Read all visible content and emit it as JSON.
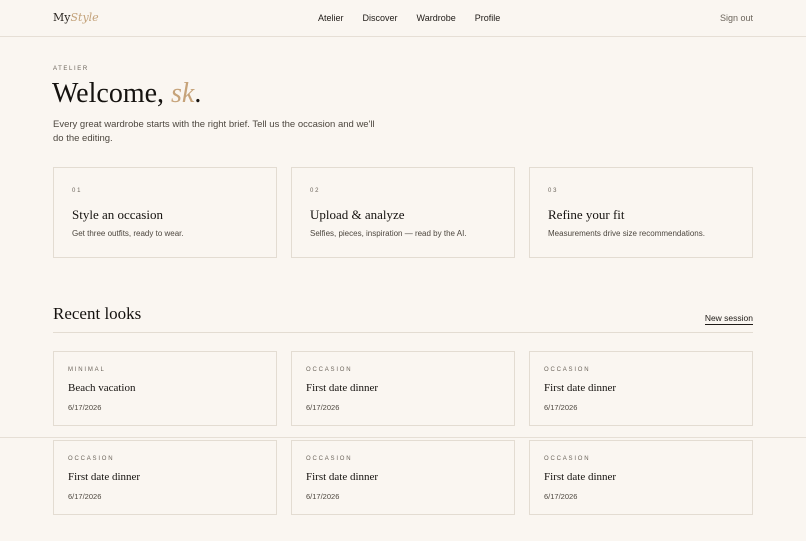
{
  "header": {
    "logo_main": "My",
    "logo_accent": "Style",
    "nav": [
      "Atelier",
      "Discover",
      "Wardrobe",
      "Profile"
    ],
    "signout": "Sign out"
  },
  "hero": {
    "eyebrow": "ATELIER",
    "welcome": "Welcome, ",
    "user": "sk",
    "period": ".",
    "intro": "Every great wardrobe starts with the right brief. Tell us the occasion and we'll do the editing."
  },
  "steps": [
    {
      "num": "01",
      "title": "Style an occasion",
      "desc": "Get three outfits, ready to wear."
    },
    {
      "num": "02",
      "title": "Upload & analyze",
      "desc": "Selfies, pieces, inspiration — read by the AI."
    },
    {
      "num": "03",
      "title": "Refine your fit",
      "desc": "Measurements drive size recommendations."
    }
  ],
  "recent": {
    "title": "Recent looks",
    "new_session": "New session",
    "items": [
      {
        "tag": "MINIMAL",
        "title": "Beach vacation",
        "date": "6/17/2026"
      },
      {
        "tag": "OCCASION",
        "title": "First date dinner",
        "date": "6/17/2026"
      },
      {
        "tag": "OCCASION",
        "title": "First date dinner",
        "date": "6/17/2026"
      },
      {
        "tag": "OCCASION",
        "title": "First date dinner",
        "date": "6/17/2026"
      },
      {
        "tag": "OCCASION",
        "title": "First date dinner",
        "date": "6/17/2026"
      },
      {
        "tag": "OCCASION",
        "title": "First date dinner",
        "date": "6/17/2026"
      }
    ]
  },
  "colors": {
    "background": "#faf6f1",
    "accent": "#c6a37a",
    "border": "#e3dcd2"
  }
}
